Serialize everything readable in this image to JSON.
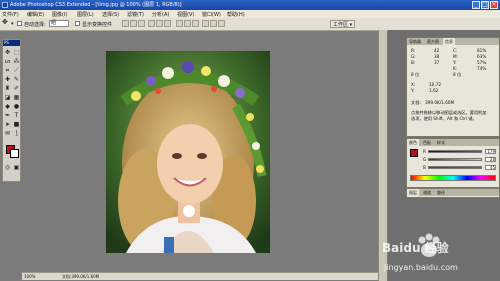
{
  "app": {
    "title": "Adobe Photoshop CS3 Extended - [timg.jpg @ 100% (图层 1, RGB/8)]"
  },
  "menu": [
    "文件(F)",
    "编辑(E)",
    "图像(I)",
    "图层(L)",
    "选择(S)",
    "滤镜(T)",
    "分析(A)",
    "视图(V)",
    "窗口(W)",
    "帮助(H)"
  ],
  "options": {
    "auto_select_label": "自动选择:",
    "auto_select_value": "组",
    "show_transform_label": "显示变换控件",
    "workspace_label": "工作区"
  },
  "toolbox": {
    "header": "PS"
  },
  "info_panel": {
    "tabs": [
      "导航器",
      "直方图",
      "信息"
    ],
    "r_label": "R:",
    "r_value": "42",
    "g_label": "G:",
    "g_value": "38",
    "b_label": "B:",
    "b_value": "37",
    "c_label": "C:",
    "c_value": "81%",
    "m_label": "M:",
    "m_value": "63%",
    "y_label": "Y:",
    "y_value": "57%",
    "k_label": "K:",
    "k_value": "74%",
    "x_label": "X:",
    "x_value": "10.72",
    "y_coord_label": "Y:",
    "y_coord_value": "1.62",
    "bits_left": "8 位",
    "bits_right": "8 位",
    "doc_label": "文档:",
    "doc_value": "399.0K/1.60M",
    "help1": "点按并拖移以移动图层或选区。要用附加",
    "help2": "选项，使用 Shift、Alt 和 Ctrl 键。"
  },
  "color_panel": {
    "tabs": [
      "颜色",
      "色板",
      "样式"
    ],
    "r_label": "R",
    "r_value": "179",
    "g_label": "G",
    "g_value": "28",
    "b_label": "B",
    "b_value": "45"
  },
  "small_panel": {
    "tabs": [
      "图层",
      "通道",
      "路径"
    ]
  },
  "status": {
    "zoom": "100%",
    "doc_info": "文档:399.0K/1.60M"
  },
  "watermark": {
    "brand": "Baidu 经验",
    "url": "jingyan.baidu.com"
  },
  "colors": {
    "foreground": "#b3141c",
    "background": "#ffffff"
  }
}
